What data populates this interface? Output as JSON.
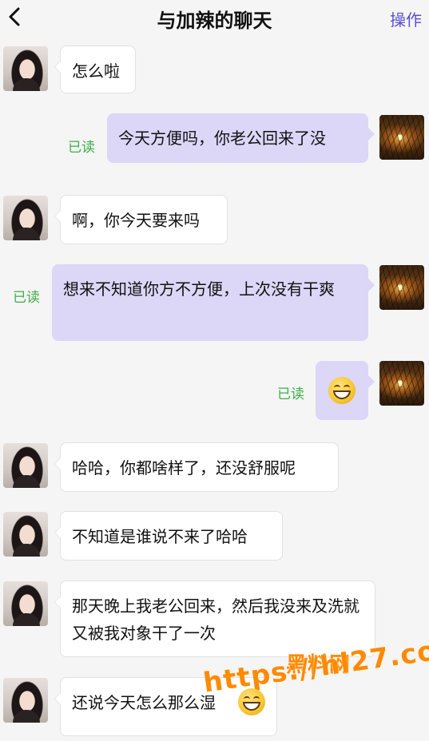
{
  "header": {
    "title": "与加辣的聊天",
    "action_label": "操作"
  },
  "read_label": "已读",
  "messages": [
    {
      "side": "in",
      "text": "怎么啦"
    },
    {
      "side": "out",
      "text": "今天方便吗，你老公回来了没",
      "read": true
    },
    {
      "side": "in",
      "text": "啊，你今天要来吗"
    },
    {
      "side": "out",
      "text": "想来不知道你方不方便，上次没有干爽",
      "read": true
    },
    {
      "side": "out",
      "text": "",
      "emoji": "grinning-face",
      "read": true
    },
    {
      "side": "in",
      "text": "哈哈，你都啥样了，还没舒服呢"
    },
    {
      "side": "in",
      "text": "不知道是谁说不来了哈哈"
    },
    {
      "side": "in",
      "text": "那天晚上我老公回来，然后我没来及洗就又被我对象干了一次"
    },
    {
      "side": "in",
      "text": "还说今天怎么那么湿"
    }
  ],
  "watermark": {
    "line1": "黑料网",
    "line2": "https://hl27.co",
    "color": "#ff8a00"
  },
  "colors": {
    "accent": "#5a4fcf",
    "outgoing_bubble": "#dcd6f7",
    "read_receipt": "#3fae4a",
    "background": "#f5f5f5"
  }
}
